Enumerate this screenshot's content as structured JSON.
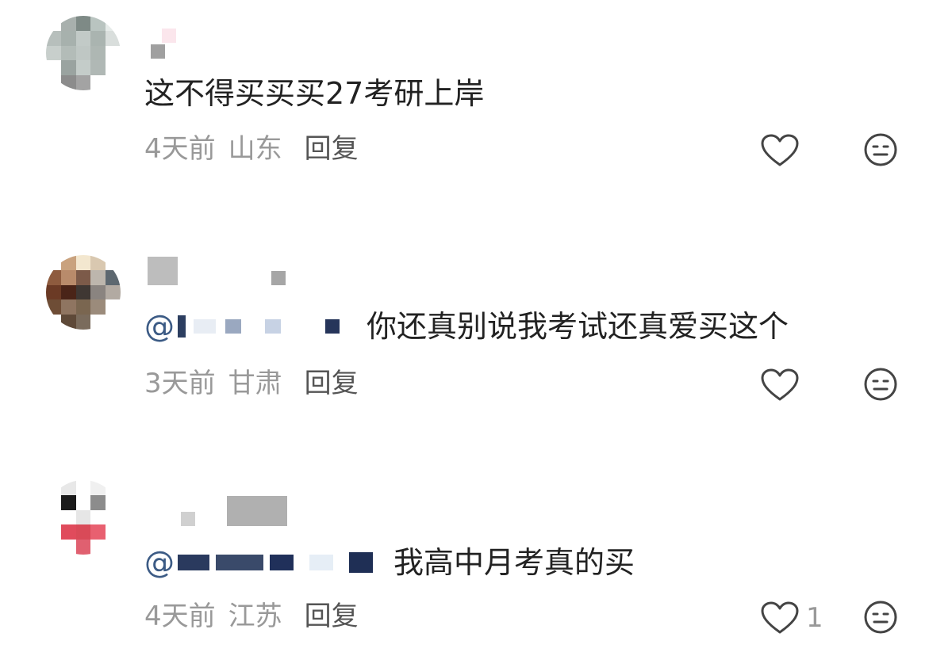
{
  "comments": [
    {
      "text": "这不得买买买27考研上岸",
      "mention": "",
      "time": "4天前",
      "location": "山东",
      "reply_label": "回复",
      "like_count": "",
      "avatar_colors": [
        "#ffffff",
        "#a8b0ad",
        "#7e8a86",
        "#b9c4c0",
        "#e6ebe9",
        "#b7bfbc",
        "#a7b1ad",
        "#c2cac7",
        "#aab4b0",
        "#d9dedc",
        "#c8cfcc",
        "#b3bcb8",
        "#bfc7c4",
        "#aeb7b3",
        "#ffffff",
        "#ffffff",
        "#9aa3a0",
        "#c4ccc9",
        "#b0b8b5",
        "#ffffff",
        "#ffffff",
        "#8c8c8c",
        "#a3a3a3",
        "#ffffff",
        "#ffffff"
      ]
    },
    {
      "text": "你还真别说我考试还真爱买这个",
      "mention": "@",
      "time": "3天前",
      "location": "甘肃",
      "reply_label": "回复",
      "like_count": "",
      "avatar_colors": [
        "#ffffff",
        "#c9a27e",
        "#f3e7cf",
        "#d9c8b0",
        "#ffffff",
        "#8e5b3e",
        "#b98b6b",
        "#7c5a49",
        "#bdb6ad",
        "#5d6870",
        "#6b3a25",
        "#4a2418",
        "#3f3733",
        "#8a8480",
        "#b2aaa2",
        "#6e4d36",
        "#8f7561",
        "#7a6650",
        "#9b8b7b",
        "#ffffff",
        "#ffffff",
        "#5e4938",
        "#7a6b5c",
        "#ffffff",
        "#ffffff"
      ]
    },
    {
      "text": "我高中月考真的买",
      "mention": "@",
      "time": "4天前",
      "location": "江苏",
      "reply_label": "回复",
      "like_count": "1",
      "avatar_colors": [
        "#ffffff",
        "#e8e8e8",
        "#ffffff",
        "#f0f0f0",
        "#ffffff",
        "#ffffff",
        "#1b1b1b",
        "#ffffff",
        "#8c8c8c",
        "#ffffff",
        "#ffffff",
        "#ffffff",
        "#e6e6e6",
        "#ffffff",
        "#ffffff",
        "#ffffff",
        "#e04b5c",
        "#d94a58",
        "#e86070",
        "#ffffff",
        "#ffffff",
        "#ffffff",
        "#e06070",
        "#ffffff",
        "#ffffff"
      ]
    }
  ],
  "icons": {
    "like": "heart-outline-icon",
    "dislike": "neutral-face-icon"
  },
  "colors": {
    "text": "#222222",
    "meta": "#999999",
    "reply": "#555555",
    "mention": "#3c5b85",
    "icon": "#444444"
  }
}
